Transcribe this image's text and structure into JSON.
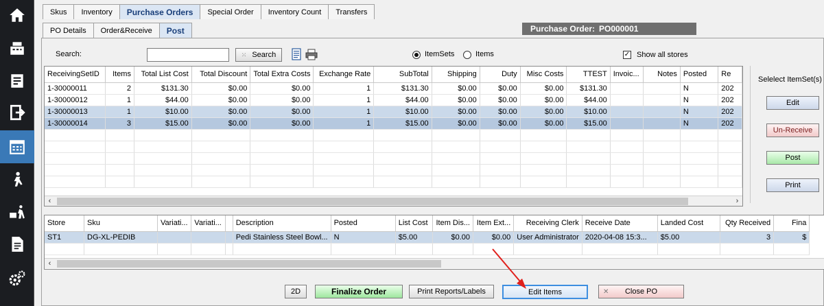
{
  "nav": {
    "items": [
      "home-icon",
      "cash-register-icon",
      "receipt-icon",
      "sign-out-icon",
      "calendar-grid-icon",
      "walking-person-icon",
      "delivery-cart-icon",
      "report-icon",
      "settings-icon"
    ],
    "active_index": 4,
    "accent": "#3a79b7"
  },
  "tabs": {
    "main": [
      "Skus",
      "Inventory",
      "Purchase Orders",
      "Special Order",
      "Inventory Count",
      "Transfers"
    ],
    "main_active": "Purchase Orders",
    "sub": [
      "PO Details",
      "Order&Receive",
      "Post"
    ],
    "sub_active": "Post"
  },
  "po": {
    "label": "Purchase Order:",
    "number": "PO000001"
  },
  "search": {
    "label": "Search:",
    "value": "",
    "button": "Search"
  },
  "view": {
    "itemsets": "ItemSets",
    "items": "Items",
    "selected": "ItemSets"
  },
  "show_all_stores": {
    "label": "Show all stores",
    "checked": true
  },
  "receiving": {
    "columns": [
      "ReceivingSetID",
      "Items",
      "Total List Cost",
      "Total Discount",
      "Total Extra Costs",
      "Exchange Rate",
      "SubTotal",
      "Shipping",
      "Duty",
      "Misc Costs",
      "TTEST",
      "Invoic...",
      "Notes",
      "Posted",
      "Re"
    ],
    "rows": [
      [
        "1-30000011",
        "2",
        "$131.30",
        "$0.00",
        "$0.00",
        "1",
        "$131.30",
        "$0.00",
        "$0.00",
        "$0.00",
        "$131.30",
        "",
        "",
        "N",
        "202"
      ],
      [
        "1-30000012",
        "1",
        "$44.00",
        "$0.00",
        "$0.00",
        "1",
        "$44.00",
        "$0.00",
        "$0.00",
        "$0.00",
        "$44.00",
        "",
        "",
        "N",
        "202"
      ],
      [
        "1-30000013",
        "1",
        "$10.00",
        "$0.00",
        "$0.00",
        "1",
        "$10.00",
        "$0.00",
        "$0.00",
        "$0.00",
        "$10.00",
        "",
        "",
        "N",
        "202"
      ],
      [
        "1-30000014",
        "3",
        "$15.00",
        "$0.00",
        "$0.00",
        "1",
        "$15.00",
        "$0.00",
        "$0.00",
        "$0.00",
        "$15.00",
        "",
        "",
        "N",
        "202"
      ]
    ]
  },
  "side": {
    "title": "Selelect ItemSet(s)",
    "edit": "Edit",
    "unreceive": "Un-Receive",
    "post": "Post",
    "print": "Print"
  },
  "items_grid": {
    "columns": [
      "Store",
      "Sku",
      "Variati...",
      "Variati...",
      "",
      "Description",
      "Posted",
      "List Cost",
      "Item Dis...",
      "Item Ext...",
      "Receiving Clerk",
      "Receive Date",
      "Landed Cost",
      "Qty Received",
      "Fina"
    ],
    "rows": [
      [
        "ST1",
        "DG-XL-PEDIB",
        "",
        "",
        "",
        "Pedi Stainless Steel Bowl...",
        "N",
        "$5.00",
        "$0.00",
        "$0.00",
        "User Administrator",
        "2020-04-08 15:3...",
        "$5.00",
        "3",
        "$"
      ]
    ]
  },
  "bottom": {
    "b2d": "2D",
    "finalize": "Finalize Order",
    "print": "Print Reports/Labels",
    "edit_items": "Edit Items",
    "close": "Close PO"
  }
}
